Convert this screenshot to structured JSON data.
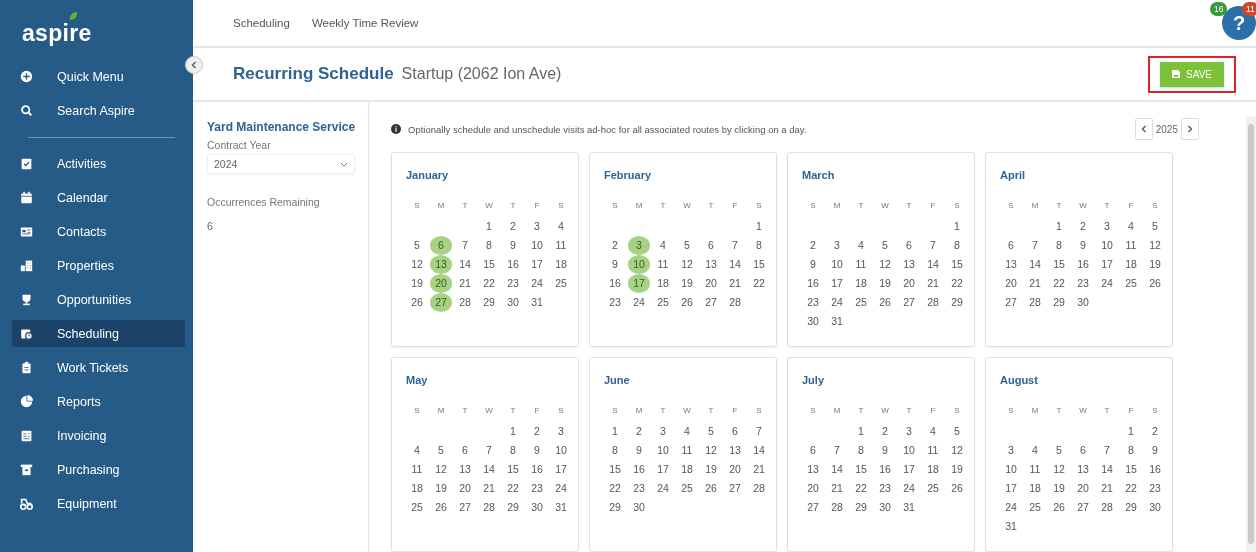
{
  "sidebar": {
    "logo": "aspire",
    "items": [
      {
        "label": "Quick Menu",
        "selected": false
      },
      {
        "label": "Search Aspire",
        "selected": false
      },
      {
        "label": "Activities",
        "selected": false
      },
      {
        "label": "Calendar",
        "selected": false
      },
      {
        "label": "Contacts",
        "selected": false
      },
      {
        "label": "Properties",
        "selected": false
      },
      {
        "label": "Opportunities",
        "selected": false
      },
      {
        "label": "Scheduling",
        "selected": true
      },
      {
        "label": "Work Tickets",
        "selected": false
      },
      {
        "label": "Reports",
        "selected": false
      },
      {
        "label": "Invoicing",
        "selected": false
      },
      {
        "label": "Purchasing",
        "selected": false
      },
      {
        "label": "Equipment",
        "selected": false
      }
    ]
  },
  "top_nav": {
    "tabs": [
      {
        "label": "Scheduling"
      },
      {
        "label": "Weekly Time Review"
      }
    ],
    "help": {
      "label": "?",
      "badges": [
        {
          "text": "16",
          "color": "#3a9a3a"
        },
        {
          "text": "11",
          "color": "#d2462a"
        }
      ]
    }
  },
  "header": {
    "title": "Recurring Schedule",
    "subtitle": "Startup (2062 Ion Ave)",
    "save_button": "SAVE"
  },
  "details": {
    "service": "Yard Maintenance Service",
    "contract_year_label": "Contract Year",
    "contract_year": "2024",
    "occurrences_label": "Occurrences Remaining",
    "occurrences": "6"
  },
  "info": "Optionally schedule and unschedule visits ad-hoc for all associated routes by clicking on a day.",
  "year": "2025",
  "months": [
    {
      "name": "January",
      "weekdays": [
        "S",
        "M",
        "T",
        "W",
        "T",
        "F",
        "S"
      ],
      "days": [
        {
          "kind": "blank"
        },
        {
          "kind": "blank"
        },
        {
          "kind": "blank"
        },
        {
          "day": "1",
          "selected": false
        },
        {
          "day": "2",
          "selected": false
        },
        {
          "day": "3",
          "selected": false
        },
        {
          "day": "4",
          "selected": false
        },
        {
          "day": "5",
          "selected": false
        },
        {
          "day": "6",
          "selected": true
        },
        {
          "day": "7",
          "selected": false
        },
        {
          "day": "8",
          "selected": false
        },
        {
          "day": "9",
          "selected": false
        },
        {
          "day": "10",
          "selected": false
        },
        {
          "day": "11",
          "selected": false
        },
        {
          "day": "12",
          "selected": false
        },
        {
          "day": "13",
          "selected": true
        },
        {
          "day": "14",
          "selected": false
        },
        {
          "day": "15",
          "selected": false
        },
        {
          "day": "16",
          "selected": false
        },
        {
          "day": "17",
          "selected": false
        },
        {
          "day": "18",
          "selected": false
        },
        {
          "day": "19",
          "selected": false
        },
        {
          "day": "20",
          "selected": true
        },
        {
          "day": "21",
          "selected": false
        },
        {
          "day": "22",
          "selected": false
        },
        {
          "day": "23",
          "selected": false
        },
        {
          "day": "24",
          "selected": false
        },
        {
          "day": "25",
          "selected": false
        },
        {
          "day": "26",
          "selected": false
        },
        {
          "day": "27",
          "selected": true
        },
        {
          "day": "28",
          "selected": false
        },
        {
          "day": "29",
          "selected": false
        },
        {
          "day": "30",
          "selected": false
        },
        {
          "day": "31",
          "selected": false
        }
      ]
    },
    {
      "name": "February",
      "weekdays": [
        "S",
        "M",
        "T",
        "W",
        "T",
        "F",
        "S"
      ],
      "days": [
        {
          "kind": "blank"
        },
        {
          "kind": "blank"
        },
        {
          "kind": "blank"
        },
        {
          "kind": "blank"
        },
        {
          "kind": "blank"
        },
        {
          "kind": "blank"
        },
        {
          "day": "1",
          "selected": false
        },
        {
          "day": "2",
          "selected": false
        },
        {
          "day": "3",
          "selected": true
        },
        {
          "day": "4",
          "selected": false
        },
        {
          "day": "5",
          "selected": false
        },
        {
          "day": "6",
          "selected": false
        },
        {
          "day": "7",
          "selected": false
        },
        {
          "day": "8",
          "selected": false
        },
        {
          "day": "9",
          "selected": false
        },
        {
          "day": "10",
          "selected": true
        },
        {
          "day": "11",
          "selected": false
        },
        {
          "day": "12",
          "selected": false
        },
        {
          "day": "13",
          "selected": false
        },
        {
          "day": "14",
          "selected": false
        },
        {
          "day": "15",
          "selected": false
        },
        {
          "day": "16",
          "selected": false
        },
        {
          "day": "17",
          "selected": true
        },
        {
          "day": "18",
          "selected": false
        },
        {
          "day": "19",
          "selected": false
        },
        {
          "day": "20",
          "selected": false
        },
        {
          "day": "21",
          "selected": false
        },
        {
          "day": "22",
          "selected": false
        },
        {
          "day": "23",
          "selected": false
        },
        {
          "day": "24",
          "selected": false
        },
        {
          "day": "25",
          "selected": false
        },
        {
          "day": "26",
          "selected": false
        },
        {
          "day": "27",
          "selected": false
        },
        {
          "day": "28",
          "selected": false
        }
      ]
    },
    {
      "name": "March",
      "weekdays": [
        "S",
        "M",
        "T",
        "W",
        "T",
        "F",
        "S"
      ],
      "days": [
        {
          "kind": "blank"
        },
        {
          "kind": "blank"
        },
        {
          "kind": "blank"
        },
        {
          "kind": "blank"
        },
        {
          "kind": "blank"
        },
        {
          "kind": "blank"
        },
        {
          "day": "1",
          "selected": false
        },
        {
          "day": "2",
          "selected": false
        },
        {
          "day": "3",
          "selected": false
        },
        {
          "day": "4",
          "selected": false
        },
        {
          "day": "5",
          "selected": false
        },
        {
          "day": "6",
          "selected": false
        },
        {
          "day": "7",
          "selected": false
        },
        {
          "day": "8",
          "selected": false
        },
        {
          "day": "9",
          "selected": false
        },
        {
          "day": "10",
          "selected": false
        },
        {
          "day": "11",
          "selected": false
        },
        {
          "day": "12",
          "selected": false
        },
        {
          "day": "13",
          "selected": false
        },
        {
          "day": "14",
          "selected": false
        },
        {
          "day": "15",
          "selected": false
        },
        {
          "day": "16",
          "selected": false
        },
        {
          "day": "17",
          "selected": false
        },
        {
          "day": "18",
          "selected": false
        },
        {
          "day": "19",
          "selected": false
        },
        {
          "day": "20",
          "selected": false
        },
        {
          "day": "21",
          "selected": false
        },
        {
          "day": "22",
          "selected": false
        },
        {
          "day": "23",
          "selected": false
        },
        {
          "day": "24",
          "selected": false
        },
        {
          "day": "25",
          "selected": false
        },
        {
          "day": "26",
          "selected": false
        },
        {
          "day": "27",
          "selected": false
        },
        {
          "day": "28",
          "selected": false
        },
        {
          "day": "29",
          "selected": false
        },
        {
          "day": "30",
          "selected": false
        },
        {
          "day": "31",
          "selected": false
        }
      ]
    },
    {
      "name": "April",
      "weekdays": [
        "S",
        "M",
        "T",
        "W",
        "T",
        "F",
        "S"
      ],
      "days": [
        {
          "kind": "blank"
        },
        {
          "kind": "blank"
        },
        {
          "day": "1",
          "selected": false
        },
        {
          "day": "2",
          "selected": false
        },
        {
          "day": "3",
          "selected": false
        },
        {
          "day": "4",
          "selected": false
        },
        {
          "day": "5",
          "selected": false
        },
        {
          "day": "6",
          "selected": false
        },
        {
          "day": "7",
          "selected": false
        },
        {
          "day": "8",
          "selected": false
        },
        {
          "day": "9",
          "selected": false
        },
        {
          "day": "10",
          "selected": false
        },
        {
          "day": "11",
          "selected": false
        },
        {
          "day": "12",
          "selected": false
        },
        {
          "day": "13",
          "selected": false
        },
        {
          "day": "14",
          "selected": false
        },
        {
          "day": "15",
          "selected": false
        },
        {
          "day": "16",
          "selected": false
        },
        {
          "day": "17",
          "selected": false
        },
        {
          "day": "18",
          "selected": false
        },
        {
          "day": "19",
          "selected": false
        },
        {
          "day": "20",
          "selected": false
        },
        {
          "day": "21",
          "selected": false
        },
        {
          "day": "22",
          "selected": false
        },
        {
          "day": "23",
          "selected": false
        },
        {
          "day": "24",
          "selected": false
        },
        {
          "day": "25",
          "selected": false
        },
        {
          "day": "26",
          "selected": false
        },
        {
          "day": "27",
          "selected": false
        },
        {
          "day": "28",
          "selected": false
        },
        {
          "day": "29",
          "selected": false
        },
        {
          "day": "30",
          "selected": false
        }
      ]
    },
    {
      "name": "May",
      "weekdays": [
        "S",
        "M",
        "T",
        "W",
        "T",
        "F",
        "S"
      ],
      "days": [
        {
          "kind": "blank"
        },
        {
          "kind": "blank"
        },
        {
          "kind": "blank"
        },
        {
          "kind": "blank"
        },
        {
          "day": "1",
          "selected": false
        },
        {
          "day": "2",
          "selected": false
        },
        {
          "day": "3",
          "selected": false
        },
        {
          "day": "4",
          "selected": false
        },
        {
          "day": "5",
          "selected": false
        },
        {
          "day": "6",
          "selected": false
        },
        {
          "day": "7",
          "selected": false
        },
        {
          "day": "8",
          "selected": false
        },
        {
          "day": "9",
          "selected": false
        },
        {
          "day": "10",
          "selected": false
        },
        {
          "day": "11",
          "selected": false
        },
        {
          "day": "12",
          "selected": false
        },
        {
          "day": "13",
          "selected": false
        },
        {
          "day": "14",
          "selected": false
        },
        {
          "day": "15",
          "selected": false
        },
        {
          "day": "16",
          "selected": false
        },
        {
          "day": "17",
          "selected": false
        },
        {
          "day": "18",
          "selected": false
        },
        {
          "day": "19",
          "selected": false
        },
        {
          "day": "20",
          "selected": false
        },
        {
          "day": "21",
          "selected": false
        },
        {
          "day": "22",
          "selected": false
        },
        {
          "day": "23",
          "selected": false
        },
        {
          "day": "24",
          "selected": false
        },
        {
          "day": "25",
          "selected": false
        },
        {
          "day": "26",
          "selected": false
        },
        {
          "day": "27",
          "selected": false
        },
        {
          "day": "28",
          "selected": false
        },
        {
          "day": "29",
          "selected": false
        },
        {
          "day": "30",
          "selected": false
        },
        {
          "day": "31",
          "selected": false
        }
      ]
    },
    {
      "name": "June",
      "weekdays": [
        "S",
        "M",
        "T",
        "W",
        "T",
        "F",
        "S"
      ],
      "days": [
        {
          "day": "1",
          "selected": false
        },
        {
          "day": "2",
          "selected": false
        },
        {
          "day": "3",
          "selected": false
        },
        {
          "day": "4",
          "selected": false
        },
        {
          "day": "5",
          "selected": false
        },
        {
          "day": "6",
          "selected": false
        },
        {
          "day": "7",
          "selected": false
        },
        {
          "day": "8",
          "selected": false
        },
        {
          "day": "9",
          "selected": false
        },
        {
          "day": "10",
          "selected": false
        },
        {
          "day": "11",
          "selected": false
        },
        {
          "day": "12",
          "selected": false
        },
        {
          "day": "13",
          "selected": false
        },
        {
          "day": "14",
          "selected": false
        },
        {
          "day": "15",
          "selected": false
        },
        {
          "day": "16",
          "selected": false
        },
        {
          "day": "17",
          "selected": false
        },
        {
          "day": "18",
          "selected": false
        },
        {
          "day": "19",
          "selected": false
        },
        {
          "day": "20",
          "selected": false
        },
        {
          "day": "21",
          "selected": false
        },
        {
          "day": "22",
          "selected": false
        },
        {
          "day": "23",
          "selected": false
        },
        {
          "day": "24",
          "selected": false
        },
        {
          "day": "25",
          "selected": false
        },
        {
          "day": "26",
          "selected": false
        },
        {
          "day": "27",
          "selected": false
        },
        {
          "day": "28",
          "selected": false
        },
        {
          "day": "29",
          "selected": false
        },
        {
          "day": "30",
          "selected": false
        }
      ]
    },
    {
      "name": "July",
      "weekdays": [
        "S",
        "M",
        "T",
        "W",
        "T",
        "F",
        "S"
      ],
      "days": [
        {
          "kind": "blank"
        },
        {
          "kind": "blank"
        },
        {
          "day": "1",
          "selected": false
        },
        {
          "day": "2",
          "selected": false
        },
        {
          "day": "3",
          "selected": false
        },
        {
          "day": "4",
          "selected": false
        },
        {
          "day": "5",
          "selected": false
        },
        {
          "day": "6",
          "selected": false
        },
        {
          "day": "7",
          "selected": false
        },
        {
          "day": "8",
          "selected": false
        },
        {
          "day": "9",
          "selected": false
        },
        {
          "day": "10",
          "selected": false
        },
        {
          "day": "11",
          "selected": false
        },
        {
          "day": "12",
          "selected": false
        },
        {
          "day": "13",
          "selected": false
        },
        {
          "day": "14",
          "selected": false
        },
        {
          "day": "15",
          "selected": false
        },
        {
          "day": "16",
          "selected": false
        },
        {
          "day": "17",
          "selected": false
        },
        {
          "day": "18",
          "selected": false
        },
        {
          "day": "19",
          "selected": false
        },
        {
          "day": "20",
          "selected": false
        },
        {
          "day": "21",
          "selected": false
        },
        {
          "day": "22",
          "selected": false
        },
        {
          "day": "23",
          "selected": false
        },
        {
          "day": "24",
          "selected": false
        },
        {
          "day": "25",
          "selected": false
        },
        {
          "day": "26",
          "selected": false
        },
        {
          "day": "27",
          "selected": false
        },
        {
          "day": "28",
          "selected": false
        },
        {
          "day": "29",
          "selected": false
        },
        {
          "day": "30",
          "selected": false
        },
        {
          "day": "31",
          "selected": false
        }
      ]
    },
    {
      "name": "August",
      "weekdays": [
        "S",
        "M",
        "T",
        "W",
        "T",
        "F",
        "S"
      ],
      "days": [
        {
          "kind": "blank"
        },
        {
          "kind": "blank"
        },
        {
          "kind": "blank"
        },
        {
          "kind": "blank"
        },
        {
          "kind": "blank"
        },
        {
          "day": "1",
          "selected": false
        },
        {
          "day": "2",
          "selected": false
        },
        {
          "day": "3",
          "selected": false
        },
        {
          "day": "4",
          "selected": false
        },
        {
          "day": "5",
          "selected": false
        },
        {
          "day": "6",
          "selected": false
        },
        {
          "day": "7",
          "selected": false
        },
        {
          "day": "8",
          "selected": false
        },
        {
          "day": "9",
          "selected": false
        },
        {
          "day": "10",
          "selected": false
        },
        {
          "day": "11",
          "selected": false
        },
        {
          "day": "12",
          "selected": false
        },
        {
          "day": "13",
          "selected": false
        },
        {
          "day": "14",
          "selected": false
        },
        {
          "day": "15",
          "selected": false
        },
        {
          "day": "16",
          "selected": false
        },
        {
          "day": "17",
          "selected": false
        },
        {
          "day": "18",
          "selected": false
        },
        {
          "day": "19",
          "selected": false
        },
        {
          "day": "20",
          "selected": false
        },
        {
          "day": "21",
          "selected": false
        },
        {
          "day": "22",
          "selected": false
        },
        {
          "day": "23",
          "selected": false
        },
        {
          "day": "24",
          "selected": false
        },
        {
          "day": "25",
          "selected": false
        },
        {
          "day": "26",
          "selected": false
        },
        {
          "day": "27",
          "selected": false
        },
        {
          "day": "28",
          "selected": false
        },
        {
          "day": "29",
          "selected": false
        },
        {
          "day": "30",
          "selected": false
        },
        {
          "day": "31",
          "selected": false
        }
      ]
    }
  ]
}
